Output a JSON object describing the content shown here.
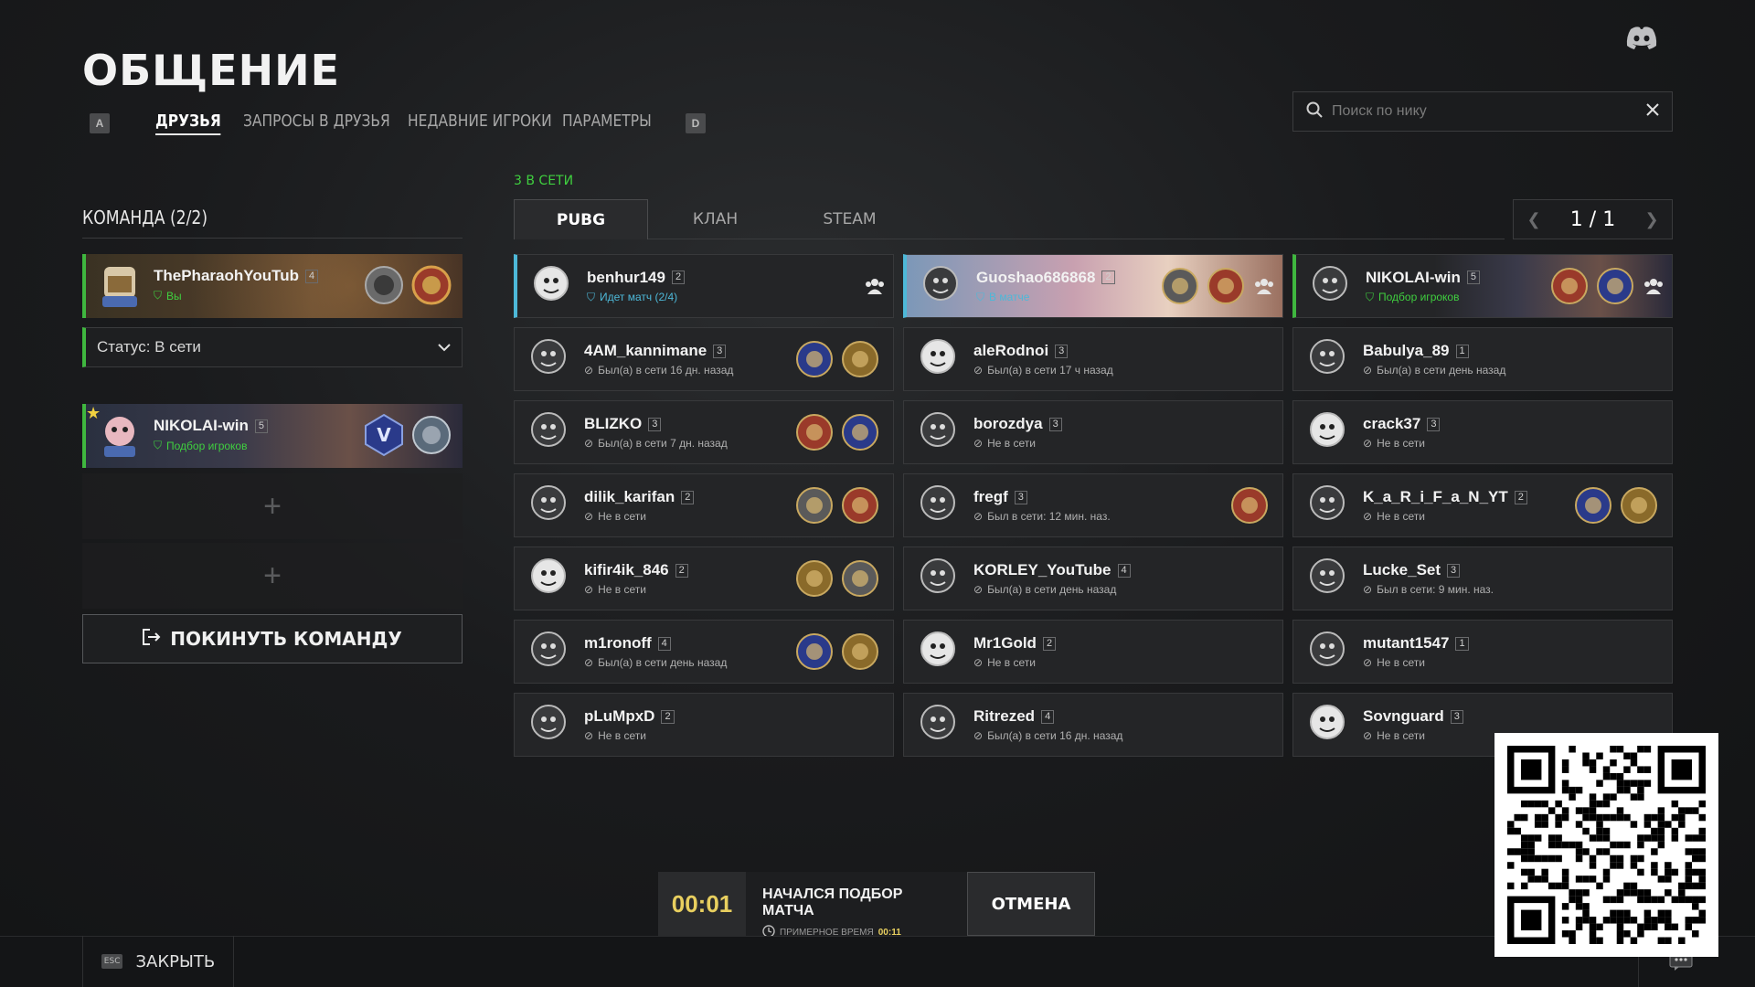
{
  "header": {
    "title": "ОБЩЕНИЕ",
    "key_left": "A",
    "key_right": "D",
    "tabs": [
      {
        "label": "ДРУЗЬЯ",
        "active": true
      },
      {
        "label": "ЗАПРОСЫ В ДРУЗЬЯ",
        "active": false
      },
      {
        "label": "НЕДАВНИЕ ИГРОКИ",
        "active": false
      },
      {
        "label": "ПАРАМЕТРЫ",
        "active": false
      }
    ],
    "search_placeholder": "Поиск по нику"
  },
  "team": {
    "title": "КОМАНДА (2/2)",
    "status_label": "Статус: В сети",
    "members": [
      {
        "name": "ThePharaohYouTub",
        "level": "4",
        "status": "Вы"
      },
      {
        "name": "NIKOLAI-win",
        "level": "5",
        "status": "Подбор игроков"
      }
    ],
    "add_symbol": "+",
    "leave_label": "ПОКИНУТЬ КОМАНДУ"
  },
  "friends": {
    "online_count": "3 В СЕТИ",
    "tabs": [
      {
        "label": "PUBG",
        "active": true
      },
      {
        "label": "КЛАН",
        "active": false
      },
      {
        "label": "STEAM",
        "active": false
      }
    ],
    "pager_text": "1 / 1",
    "list": [
      {
        "name": "benhur149",
        "level": "2",
        "status": "Идет матч (2/4)",
        "state": "online"
      },
      {
        "name": "Guoshao686868",
        "level": "2",
        "status": "В матче",
        "state": "online"
      },
      {
        "name": "NIKOLAI-win",
        "level": "5",
        "status": "Подбор игроков",
        "state": "lobby"
      },
      {
        "name": "4AM_kannimane",
        "level": "3",
        "status": "Был(а) в сети 16 дн. назад",
        "state": "offline"
      },
      {
        "name": "aleRodnoi",
        "level": "3",
        "status": "Был(а) в сети 17 ч назад",
        "state": "offline"
      },
      {
        "name": "Babulya_89",
        "level": "1",
        "status": "Был(а) в сети день назад",
        "state": "offline"
      },
      {
        "name": "BLIZKO",
        "level": "3",
        "status": "Был(а) в сети 7 дн. назад",
        "state": "offline"
      },
      {
        "name": "borozdya",
        "level": "3",
        "status": "Не в сети",
        "state": "offline"
      },
      {
        "name": "crack37",
        "level": "3",
        "status": "Не в сети",
        "state": "offline"
      },
      {
        "name": "dilik_karifan",
        "level": "2",
        "status": "Не в сети",
        "state": "offline"
      },
      {
        "name": "fregf",
        "level": "3",
        "status": "Был в сети: 12 мин. наз.",
        "state": "offline"
      },
      {
        "name": "K_a_R_i_F_a_N_YT",
        "level": "2",
        "status": "Не в сети",
        "state": "offline"
      },
      {
        "name": "kifir4ik_846",
        "level": "2",
        "status": "Не в сети",
        "state": "offline"
      },
      {
        "name": "KORLEY_YouTube",
        "level": "4",
        "status": "Был(а) в сети день назад",
        "state": "offline"
      },
      {
        "name": "Lucke_Set",
        "level": "3",
        "status": "Был в сети: 9 мин. наз.",
        "state": "offline"
      },
      {
        "name": "m1ronoff",
        "level": "4",
        "status": "Был(а) в сети день назад",
        "state": "offline"
      },
      {
        "name": "Mr1Gold",
        "level": "2",
        "status": "Не в сети",
        "state": "offline"
      },
      {
        "name": "mutant1547",
        "level": "1",
        "status": "Не в сети",
        "state": "offline"
      },
      {
        "name": "pLuMpxD",
        "level": "2",
        "status": "Не в сети",
        "state": "offline"
      },
      {
        "name": "Ritrezed",
        "level": "4",
        "status": "Был(а) в сети 16 дн. назад",
        "state": "offline"
      },
      {
        "name": "Sovnguard",
        "level": "3",
        "status": "Не в сети",
        "state": "offline"
      }
    ]
  },
  "matchmaking": {
    "timer": "00:01",
    "title": "НАЧАЛСЯ ПОДБОР МАТЧА",
    "estimate_label": "ПРИМЕРНОЕ ВРЕМЯ",
    "estimate_value": "00:11",
    "cancel_label": "ОТМЕНА"
  },
  "footer": {
    "esc_key": "ESC",
    "close_label": "ЗАКРЫТЬ"
  },
  "colors": {
    "online": "#4db8d8",
    "lobby": "#3fb73f",
    "timer": "#e8cf5f"
  }
}
